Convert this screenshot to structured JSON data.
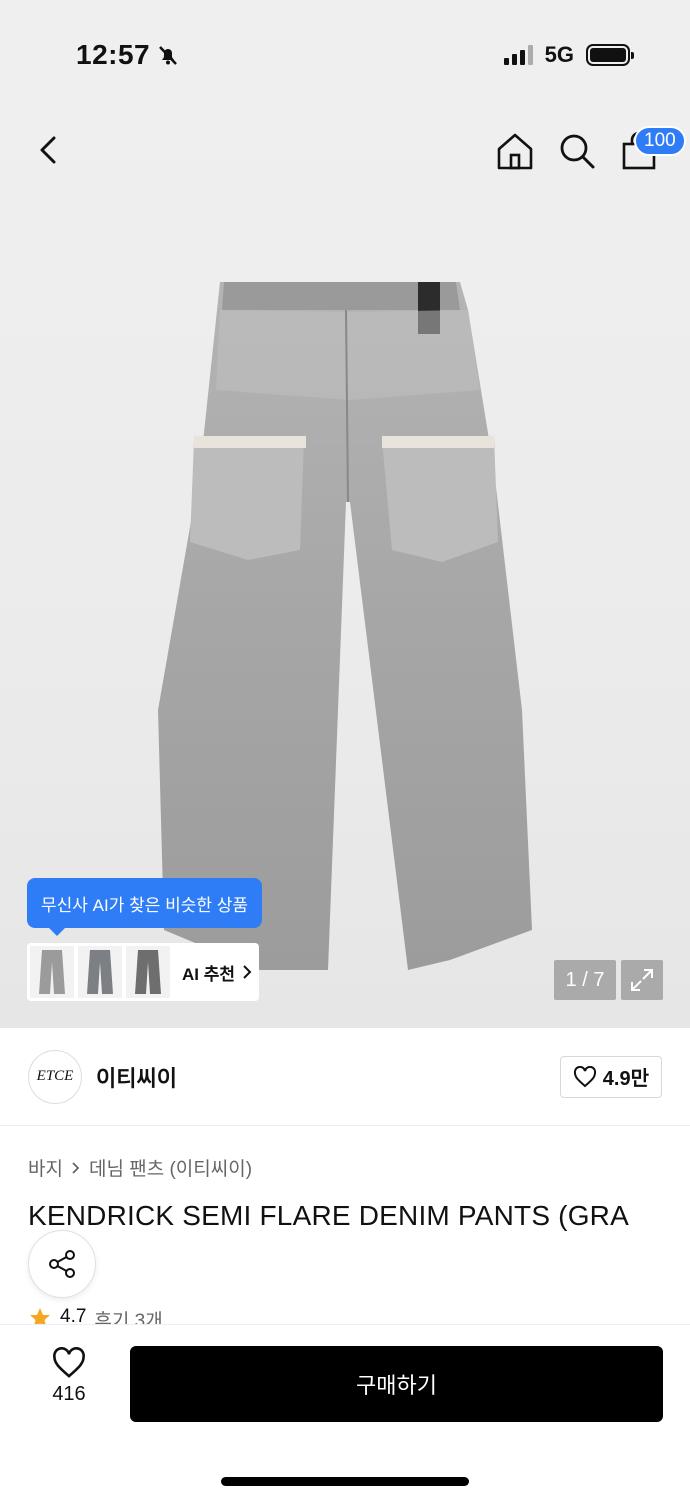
{
  "status": {
    "time": "12:57",
    "network": "5G"
  },
  "nav": {
    "cart_count": "100"
  },
  "gallery": {
    "counter": "1 / 7",
    "ai_tooltip": "무신사 AI가 찾은 비슷한 상품",
    "ai_label": "AI 추천"
  },
  "brand": {
    "logo_text": "ETCE",
    "name": "이티씨이",
    "likes": "4.9만"
  },
  "breadcrumb": {
    "category": "바지",
    "subcategory": "데님 팬츠 (이티씨이)"
  },
  "product": {
    "title": "KENDRICK SEMI FLARE DENIM PANTS (GRA",
    "rating": "4.7",
    "reviews": "후기 3개"
  },
  "bottom": {
    "wish_count": "416",
    "buy_label": "구매하기"
  },
  "colors": {
    "accent": "#2f7df6",
    "denim": "#a9a9a9"
  }
}
